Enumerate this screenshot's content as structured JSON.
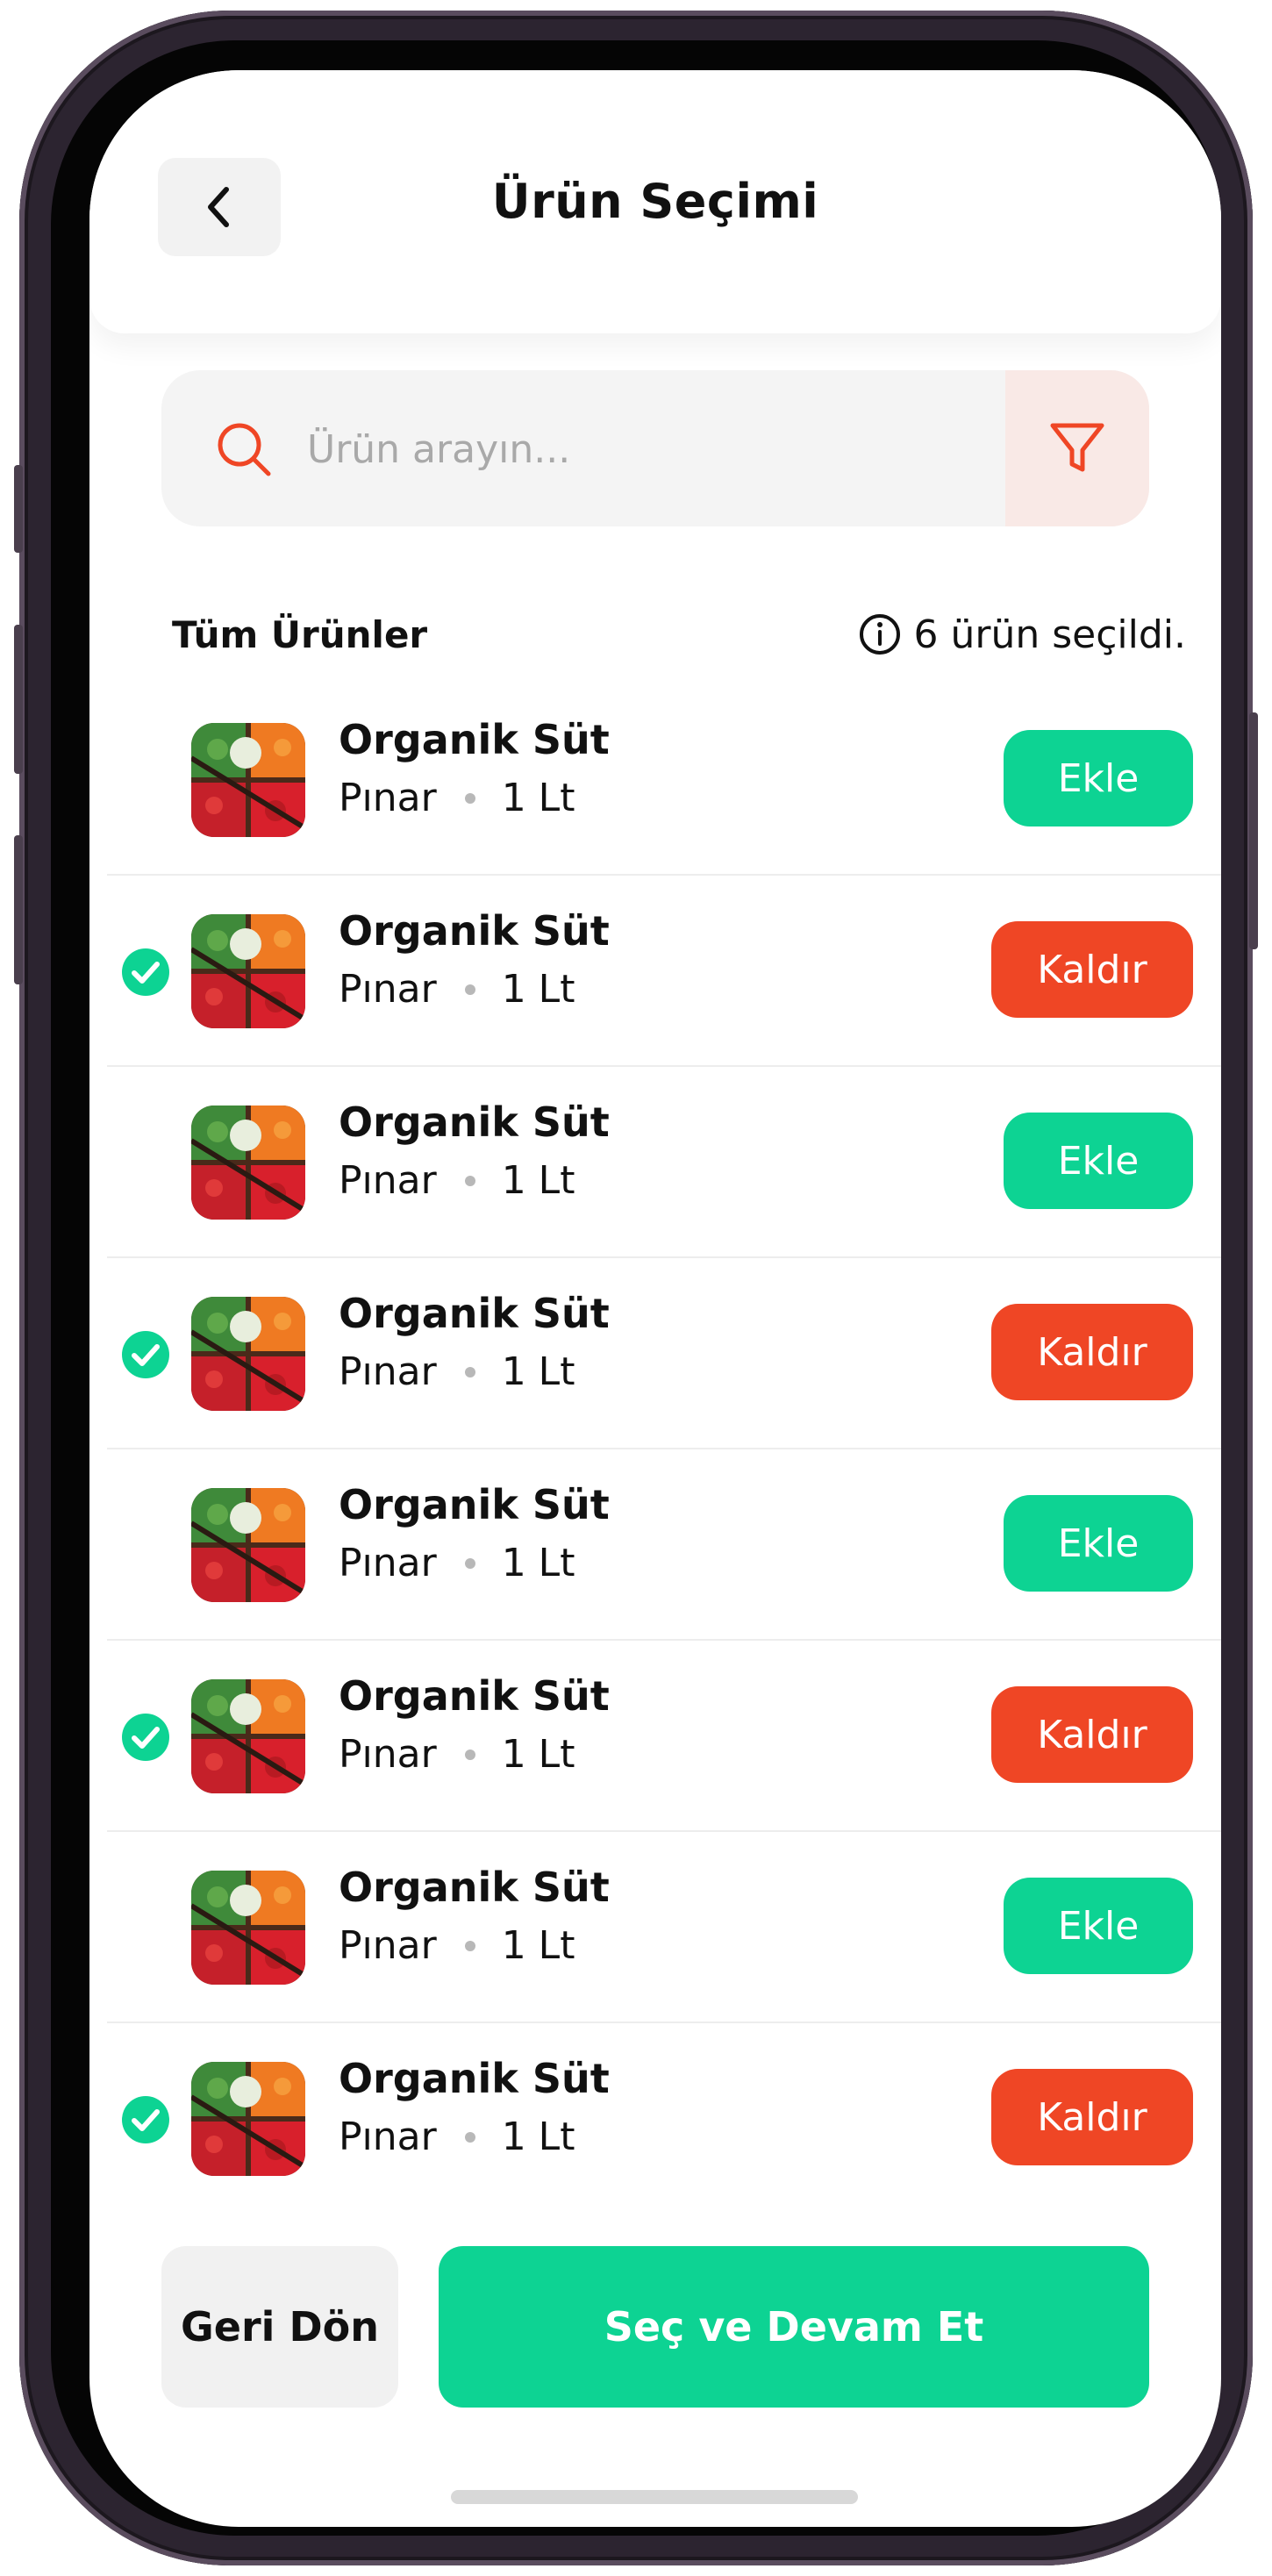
{
  "header": {
    "title": "Ürün Seçimi",
    "back_icon": "chevron-left-icon"
  },
  "search": {
    "placeholder": "Ürün arayın...",
    "value": "",
    "icon": "search-icon",
    "filter_icon": "filter-icon"
  },
  "section": {
    "title": "Tüm Ürünler",
    "selected_text": "6 ürün seçildi.",
    "info_icon": "info-icon"
  },
  "products": [
    {
      "name": "Organik Süt",
      "brand": "Pınar",
      "size": "1 Lt",
      "selected": false,
      "action": "Ekle"
    },
    {
      "name": "Organik Süt",
      "brand": "Pınar",
      "size": "1 Lt",
      "selected": true,
      "action": "Kaldır"
    },
    {
      "name": "Organik Süt",
      "brand": "Pınar",
      "size": "1 Lt",
      "selected": false,
      "action": "Ekle"
    },
    {
      "name": "Organik Süt",
      "brand": "Pınar",
      "size": "1 Lt",
      "selected": true,
      "action": "Kaldır"
    },
    {
      "name": "Organik Süt",
      "brand": "Pınar",
      "size": "1 Lt",
      "selected": false,
      "action": "Ekle"
    },
    {
      "name": "Organik Süt",
      "brand": "Pınar",
      "size": "1 Lt",
      "selected": true,
      "action": "Kaldır"
    },
    {
      "name": "Organik Süt",
      "brand": "Pınar",
      "size": "1 Lt",
      "selected": false,
      "action": "Ekle"
    },
    {
      "name": "Organik Süt",
      "brand": "Pınar",
      "size": "1 Lt",
      "selected": true,
      "action": "Kaldır"
    }
  ],
  "footer": {
    "back_label": "Geri Dön",
    "continue_label": "Seç ve Devam Et"
  },
  "colors": {
    "accent_green": "#0dd393",
    "accent_red": "#ef4625",
    "search_bg": "#f4f4f4",
    "filter_bg": "#f9e9e6"
  }
}
